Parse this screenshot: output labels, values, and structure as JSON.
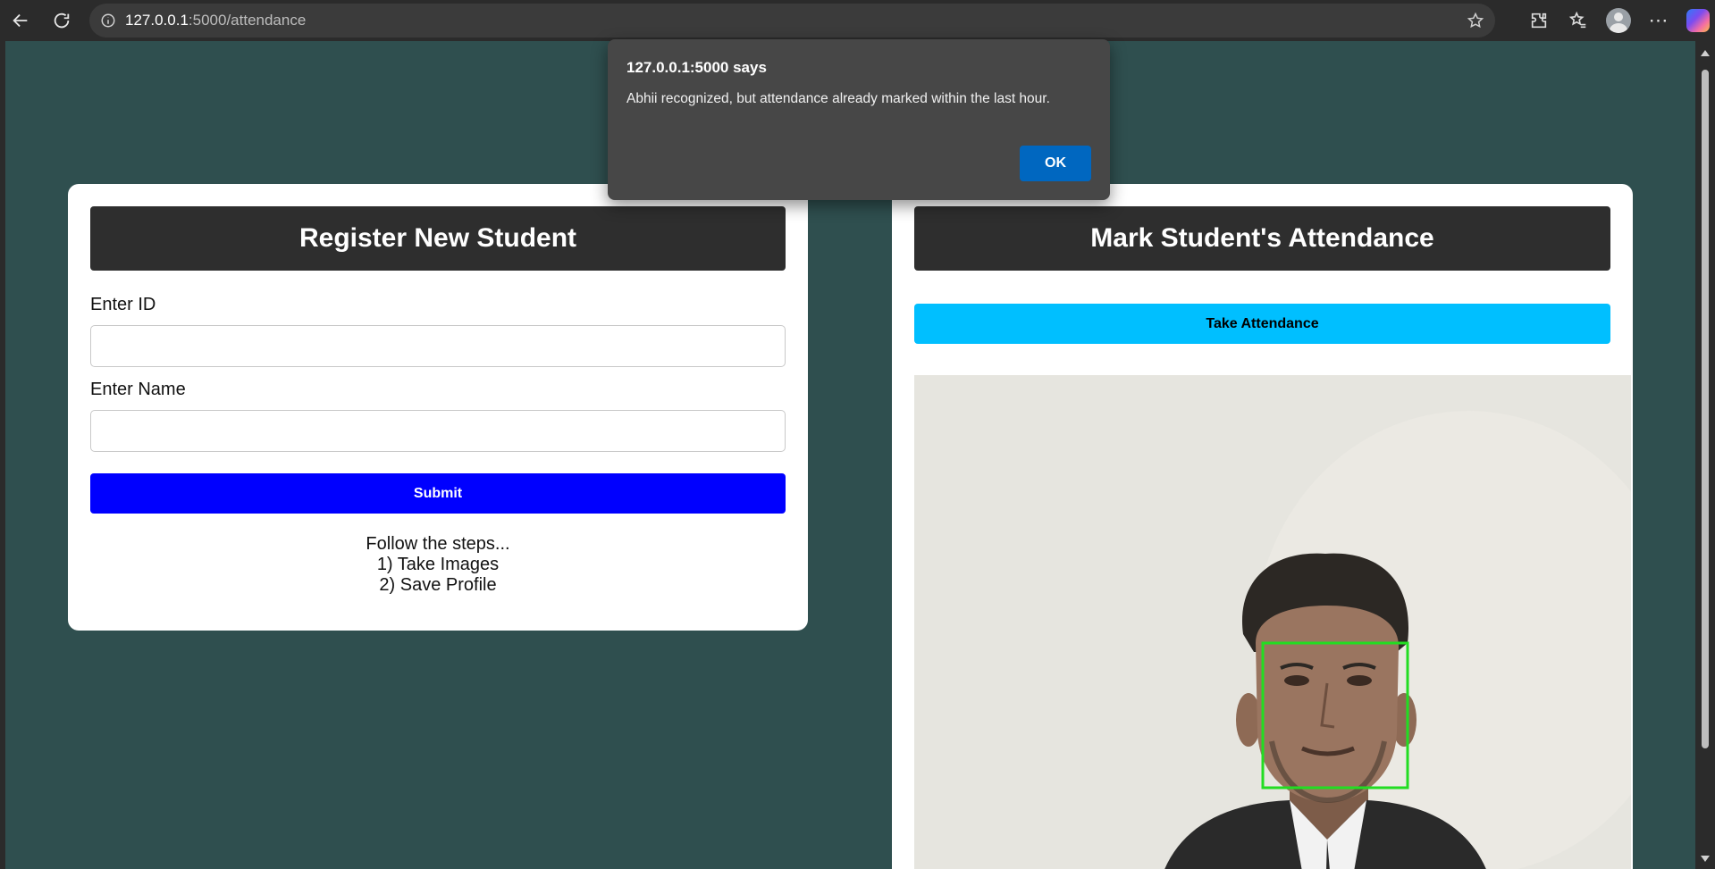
{
  "browser": {
    "url_host": "127.0.0.1",
    "url_path": ":5000/attendance"
  },
  "register": {
    "title": "Register New Student",
    "id_label": "Enter ID",
    "id_value": "",
    "name_label": "Enter Name",
    "name_value": "",
    "submit_label": "Submit",
    "steps_line1": "Follow the steps...",
    "steps_line2": "1) Take Images",
    "steps_line3": "2) Save Profile"
  },
  "attendance": {
    "title": "Mark Student's Attendance",
    "take_button_label": "Take Attendance"
  },
  "dialog": {
    "title": "127.0.0.1:5000 says",
    "message": "Abhii recognized, but attendance already marked within the last hour.",
    "ok_label": "OK"
  },
  "colors": {
    "page_background": "#2f4f4f",
    "submit_button": "#0000ff",
    "take_attendance_button": "#00bfff",
    "face_box": "#22dd22"
  }
}
